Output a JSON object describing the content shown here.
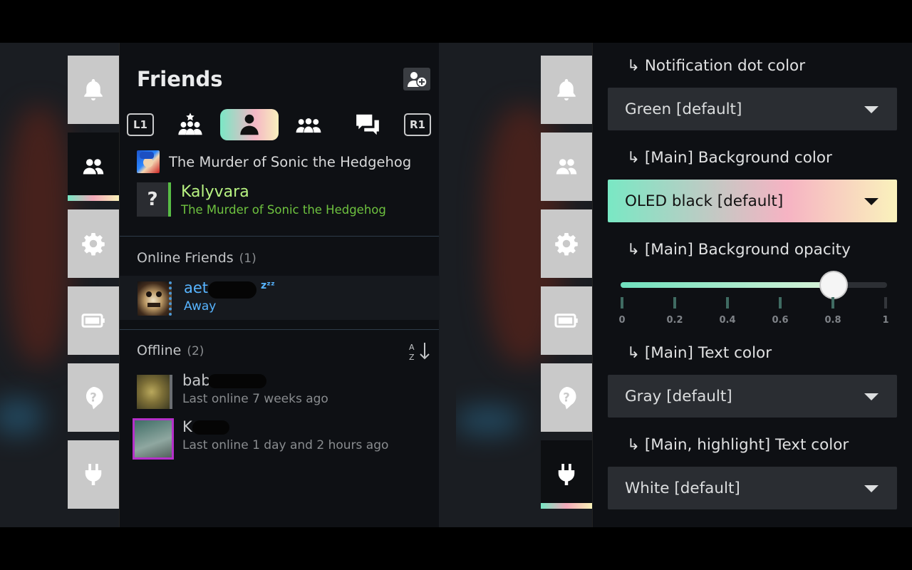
{
  "left_screen": {
    "qam_tabs": [
      {
        "icon": "bell-icon",
        "active": false
      },
      {
        "icon": "friends-icon",
        "active": true
      },
      {
        "icon": "gear-icon",
        "active": false
      },
      {
        "icon": "battery-icon",
        "active": false
      },
      {
        "icon": "help-icon",
        "active": false
      },
      {
        "icon": "plug-icon",
        "active": false
      }
    ],
    "friends": {
      "title": "Friends",
      "tab_hint_left": "L1",
      "tab_hint_right": "R1",
      "tabs": [
        "favorites-icon",
        "friend-icon",
        "group-icon",
        "chat-icon"
      ],
      "active_tab": "friend-icon",
      "in_game": {
        "game_title": "The Murder of Sonic the Hedgehog",
        "friend_avatar": "?",
        "friend_name": "Kalyvara",
        "friend_game": "The Murder of Sonic the Hedgehog"
      },
      "online": {
        "header": "Online Friends",
        "count": "(1)",
        "friends": [
          {
            "name": "aet",
            "zzz": "zᶻᶻ",
            "status": "Away"
          }
        ]
      },
      "offline": {
        "header": "Offline",
        "count": "(2)",
        "friends": [
          {
            "name": "bab",
            "status": "Last online 7 weeks ago"
          },
          {
            "name": "K",
            "status": "Last online 1 day and 2 hours ago"
          }
        ]
      }
    }
  },
  "right_screen": {
    "qam_tabs": [
      {
        "icon": "bell-icon",
        "active": false
      },
      {
        "icon": "friends-icon",
        "active": false
      },
      {
        "icon": "gear-icon",
        "active": false
      },
      {
        "icon": "battery-icon",
        "active": false
      },
      {
        "icon": "help-icon",
        "active": false
      },
      {
        "icon": "plug-icon",
        "active": true
      }
    ],
    "settings": {
      "notification_dot_label": "↳ Notification dot color",
      "notification_dot_value": "Green [default]",
      "bg_color_label": "↳ [Main] Background color",
      "bg_color_value": "OLED black [default]",
      "bg_opacity_label": "↳ [Main] Background opacity",
      "bg_opacity_value": 0.8,
      "slider_ticks": [
        "0",
        "0.2",
        "0.4",
        "0.6",
        "0.8",
        "1"
      ],
      "text_color_label": "↳ [Main] Text color",
      "text_color_value": "Gray [default]",
      "highlight_text_label": "↳ [Main, highlight] Text color",
      "highlight_text_value": "White [default]"
    }
  },
  "colors": {
    "accent_gradient": [
      "#75e6c3",
      "#f3a9b9",
      "#f9f1b8"
    ],
    "in_game_green": "#b8f382",
    "online_blue": "#57b4ff"
  }
}
